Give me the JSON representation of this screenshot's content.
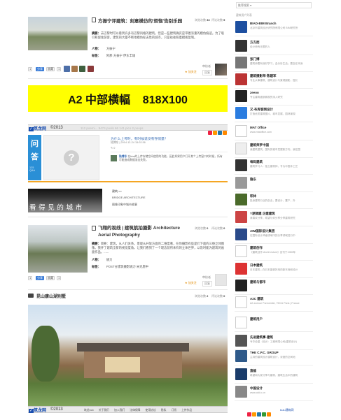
{
  "post1": {
    "title": "方振宁评建筑：刻意模仿的'烦恼'告别乐园",
    "views_label": "浏览次数",
    "views": "33",
    "comments_label": "评论次数",
    "comments": "5",
    "excerpt_label": "摘要：",
    "excerpt": "去巴黎时可以看到许多有巴黎风格的建筑，但是一些建筑确实是带着浓重的模仿痕迹。为了吸引和留住游客，建筑的大厦不断地模仿标志性的城市，只是往往照着模板复制。",
    "author_label": "人物：",
    "author": "方振宁",
    "tags_label": "标签：",
    "tags": "阿那·方振宁 伊东丰雄",
    "chip_count": "1",
    "chip_share": "分享",
    "chip_fav": "收藏",
    "chip_num": "1",
    "fav_action": "★ 加关注",
    "reply": "回复",
    "reviewer": "审核者"
  },
  "banner": {
    "text": "A2 中部横幅    818X100"
  },
  "bar1": {
    "logo": "筑龙网",
    "copy": "©2013",
    "faded": "112 poemi...    9474 pools   66 141 pico   2 poops"
  },
  "qa": {
    "title": "为什么上传时，有时候说没有存储量？",
    "meta": "陆博东 | 2014-12-24 15:02:36",
    "count": "0",
    "label_top": "问",
    "label_bot": "答",
    "answers_label": "125",
    "answers_sub": "Q&A",
    "reply_name": "陆博东",
    "reply": "在bbs的上传存储空间使用的功能，因此如果用户打开某个上传窗口的时候，所有可能造成数据溢出失败。"
  },
  "feature": {
    "overlay": "看 得 见 的 城 市",
    "kicker": "建筑 >>",
    "sub": "BRIDGE ARCHITECTURE",
    "desc": "图像印象中城市故事"
  },
  "post2": {
    "title": "飞翔的视线 | 建筑航拍摄影 Architecture Aerial Photography",
    "views_label": "浏览次数",
    "views": "0",
    "comments_label": "评论次数",
    "comments": "0",
    "excerpt_label": "摘要：",
    "excerpt": "简要：建筑，从人们关系，景观从开放方面的二维度看，在你摄影有些是们下面的三维立体图像。我开了建筑全新的视觉度角，让我们看到了一个理念前所未有的立体世界，以及时能为建筑的画面作品。......",
    "author_label": "人物：",
    "author": "姚力",
    "tags_label": "标签：",
    "tags": "POST分建筑摄影姚力 米克唐中",
    "chip_count": "1",
    "chip_share": "分享",
    "chip_fav": "收藏",
    "chip_num": "1",
    "fav_action": "★ 加关注",
    "reply": "回复",
    "reviewer": "审核者"
  },
  "post3": {
    "title": "昆山康山湖别墅",
    "views_label": "浏览次数",
    "views": "2",
    "comments_label": "评论次数",
    "comments": "0"
  },
  "bar2": {
    "logo": "筑龙网",
    "copy": "©2013",
    "links": [
      "筑龙bcb",
      "关于我们",
      "加入我们",
      "法律保障",
      "使用协议",
      "隐私",
      "订阅",
      "上传作品"
    ],
    "right": "bulu建筑网"
  },
  "sidebar": {
    "search_placeholder": "推荐搜索 ▾",
    "section_label": "建筑用户列表",
    "items": [
      {
        "name": "BIAD-BIM Branch",
        "desc": "北京市建筑设计研究院有限公司 BIM研究所"
      },
      {
        "name": "方方而",
        "desc": "设计师有无限的人"
      },
      {
        "name": "张门博",
        "desc": "建筑师要有良好学习，会分析生活；要会在本身"
      },
      {
        "name": "建筑摄影师·陈建军",
        "desc": "专业从事建筑、建筑设计与景观摄影，擅长"
      },
      {
        "name": "zeeoo",
        "desc": "专注建筑细部微观的深入研究"
      },
      {
        "name": "又·布库客网设计",
        "desc": "打造优质建筑图片、城市发展、园林景观"
      },
      {
        "name": "MAT Office",
        "desc": "www.matoffice.com"
      },
      {
        "name": "建筑师罗中国",
        "desc": "我建筑建筑，国际的城市发展新方向，我在国"
      },
      {
        "name": "每码建筑",
        "desc": "建筑学习人：独立建筑师，专为中国手工艺"
      },
      {
        "name": "隐东",
        "desc": ""
      },
      {
        "name": "积林",
        "desc": "投身建筑行业的创业，要设计，置产，外"
      },
      {
        "name": "Y逻辑建 企建建筑",
        "desc": "我喜欢分享，希望与你分享分享建筑研究"
      },
      {
        "name": "AIM国际设计集团",
        "desc": "在国际设计风格领域中的分享领域进行中"
      },
      {
        "name": "建筑创作",
        "desc": "《建筑创作 Archit esture》创刊于1989年"
      },
      {
        "name": "日本建筑",
        "desc": "日本建筑—在日本能够好用的新东西和设计"
      },
      {
        "name": "建筑与都市",
        "desc": ""
      },
      {
        "name": "A2C 建筑",
        "desc": "A2 avenue Parmentier, 75011 Paris | France"
      },
      {
        "name": "建筑用户",
        "desc": ""
      },
      {
        "name": "先进建筑事·建筑",
        "desc": "专华设建（设计）工程有限公司(建筑设计)"
      },
      {
        "name": "THE C.P.C. GROUP",
        "desc": "主持的建筑设计建筑设计，深度的空间地"
      },
      {
        "name": "直植",
        "desc": "希望和大家分享与建筑，建筑生活中的建筑"
      },
      {
        "name": "中国设计",
        "desc": "www.cdd.c.cn"
      }
    ],
    "more_label": "建筑用户"
  }
}
